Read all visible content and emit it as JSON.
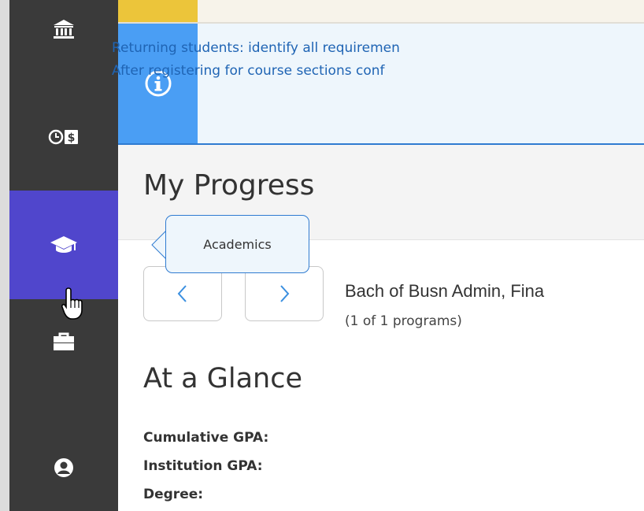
{
  "sidebar": {
    "items": [
      {
        "name": "institution",
        "icon": "bank-icon"
      },
      {
        "name": "financial",
        "icon": "clock-dollar-icon"
      },
      {
        "name": "academics",
        "icon": "graduation-cap-icon",
        "active": true
      },
      {
        "name": "career",
        "icon": "briefcase-icon"
      },
      {
        "name": "profile",
        "icon": "user-circle-icon"
      }
    ],
    "active_color": "#5046cc"
  },
  "tooltip": {
    "text": "Academics"
  },
  "banner": {
    "icon": "info-circle-icon",
    "line1": "Returning students: identify all requiremen",
    "line2": "After registering for course sections conf"
  },
  "page": {
    "title": "My Progress"
  },
  "program": {
    "prev_icon": "chevron-left-icon",
    "next_icon": "chevron-right-icon",
    "name": "Bach of Busn Admin, Fina",
    "count": "(1 of 1 programs)"
  },
  "glance": {
    "title": "At a Glance",
    "labels": [
      "Cumulative GPA:",
      "Institution GPA:",
      "Degree:"
    ]
  },
  "colors": {
    "sidebar_bg": "#3a3a3a",
    "accent_yellow": "#ecc53a",
    "info_blue": "#4a9ef4",
    "link_blue": "#1f64b4"
  }
}
